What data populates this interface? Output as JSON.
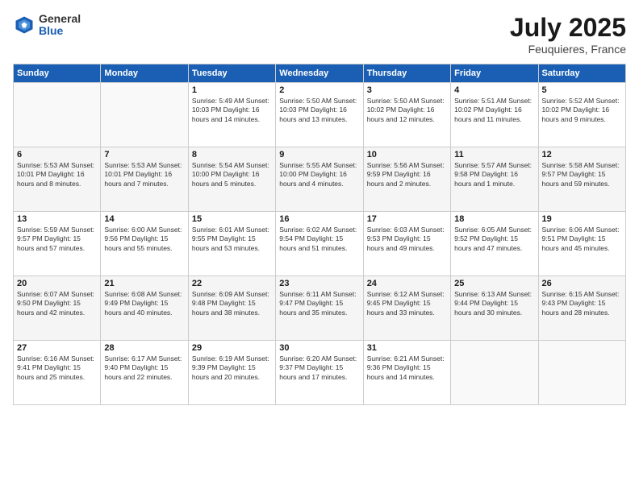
{
  "header": {
    "logo_general": "General",
    "logo_blue": "Blue",
    "title": "July 2025",
    "location": "Feuquieres, France"
  },
  "days_of_week": [
    "Sunday",
    "Monday",
    "Tuesday",
    "Wednesday",
    "Thursday",
    "Friday",
    "Saturday"
  ],
  "weeks": [
    [
      {
        "day": "",
        "info": ""
      },
      {
        "day": "",
        "info": ""
      },
      {
        "day": "1",
        "info": "Sunrise: 5:49 AM\nSunset: 10:03 PM\nDaylight: 16 hours and 14 minutes."
      },
      {
        "day": "2",
        "info": "Sunrise: 5:50 AM\nSunset: 10:03 PM\nDaylight: 16 hours and 13 minutes."
      },
      {
        "day": "3",
        "info": "Sunrise: 5:50 AM\nSunset: 10:02 PM\nDaylight: 16 hours and 12 minutes."
      },
      {
        "day": "4",
        "info": "Sunrise: 5:51 AM\nSunset: 10:02 PM\nDaylight: 16 hours and 11 minutes."
      },
      {
        "day": "5",
        "info": "Sunrise: 5:52 AM\nSunset: 10:02 PM\nDaylight: 16 hours and 9 minutes."
      }
    ],
    [
      {
        "day": "6",
        "info": "Sunrise: 5:53 AM\nSunset: 10:01 PM\nDaylight: 16 hours and 8 minutes."
      },
      {
        "day": "7",
        "info": "Sunrise: 5:53 AM\nSunset: 10:01 PM\nDaylight: 16 hours and 7 minutes."
      },
      {
        "day": "8",
        "info": "Sunrise: 5:54 AM\nSunset: 10:00 PM\nDaylight: 16 hours and 5 minutes."
      },
      {
        "day": "9",
        "info": "Sunrise: 5:55 AM\nSunset: 10:00 PM\nDaylight: 16 hours and 4 minutes."
      },
      {
        "day": "10",
        "info": "Sunrise: 5:56 AM\nSunset: 9:59 PM\nDaylight: 16 hours and 2 minutes."
      },
      {
        "day": "11",
        "info": "Sunrise: 5:57 AM\nSunset: 9:58 PM\nDaylight: 16 hours and 1 minute."
      },
      {
        "day": "12",
        "info": "Sunrise: 5:58 AM\nSunset: 9:57 PM\nDaylight: 15 hours and 59 minutes."
      }
    ],
    [
      {
        "day": "13",
        "info": "Sunrise: 5:59 AM\nSunset: 9:57 PM\nDaylight: 15 hours and 57 minutes."
      },
      {
        "day": "14",
        "info": "Sunrise: 6:00 AM\nSunset: 9:56 PM\nDaylight: 15 hours and 55 minutes."
      },
      {
        "day": "15",
        "info": "Sunrise: 6:01 AM\nSunset: 9:55 PM\nDaylight: 15 hours and 53 minutes."
      },
      {
        "day": "16",
        "info": "Sunrise: 6:02 AM\nSunset: 9:54 PM\nDaylight: 15 hours and 51 minutes."
      },
      {
        "day": "17",
        "info": "Sunrise: 6:03 AM\nSunset: 9:53 PM\nDaylight: 15 hours and 49 minutes."
      },
      {
        "day": "18",
        "info": "Sunrise: 6:05 AM\nSunset: 9:52 PM\nDaylight: 15 hours and 47 minutes."
      },
      {
        "day": "19",
        "info": "Sunrise: 6:06 AM\nSunset: 9:51 PM\nDaylight: 15 hours and 45 minutes."
      }
    ],
    [
      {
        "day": "20",
        "info": "Sunrise: 6:07 AM\nSunset: 9:50 PM\nDaylight: 15 hours and 42 minutes."
      },
      {
        "day": "21",
        "info": "Sunrise: 6:08 AM\nSunset: 9:49 PM\nDaylight: 15 hours and 40 minutes."
      },
      {
        "day": "22",
        "info": "Sunrise: 6:09 AM\nSunset: 9:48 PM\nDaylight: 15 hours and 38 minutes."
      },
      {
        "day": "23",
        "info": "Sunrise: 6:11 AM\nSunset: 9:47 PM\nDaylight: 15 hours and 35 minutes."
      },
      {
        "day": "24",
        "info": "Sunrise: 6:12 AM\nSunset: 9:45 PM\nDaylight: 15 hours and 33 minutes."
      },
      {
        "day": "25",
        "info": "Sunrise: 6:13 AM\nSunset: 9:44 PM\nDaylight: 15 hours and 30 minutes."
      },
      {
        "day": "26",
        "info": "Sunrise: 6:15 AM\nSunset: 9:43 PM\nDaylight: 15 hours and 28 minutes."
      }
    ],
    [
      {
        "day": "27",
        "info": "Sunrise: 6:16 AM\nSunset: 9:41 PM\nDaylight: 15 hours and 25 minutes."
      },
      {
        "day": "28",
        "info": "Sunrise: 6:17 AM\nSunset: 9:40 PM\nDaylight: 15 hours and 22 minutes."
      },
      {
        "day": "29",
        "info": "Sunrise: 6:19 AM\nSunset: 9:39 PM\nDaylight: 15 hours and 20 minutes."
      },
      {
        "day": "30",
        "info": "Sunrise: 6:20 AM\nSunset: 9:37 PM\nDaylight: 15 hours and 17 minutes."
      },
      {
        "day": "31",
        "info": "Sunrise: 6:21 AM\nSunset: 9:36 PM\nDaylight: 15 hours and 14 minutes."
      },
      {
        "day": "",
        "info": ""
      },
      {
        "day": "",
        "info": ""
      }
    ]
  ]
}
